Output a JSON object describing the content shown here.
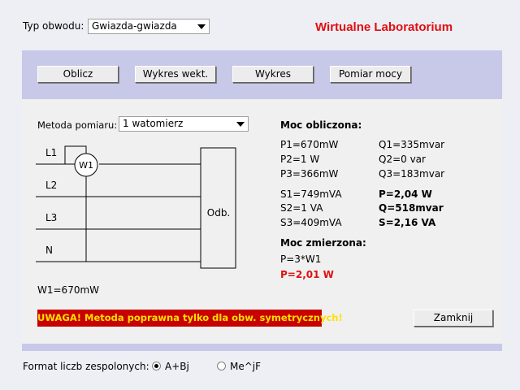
{
  "header": {
    "circuit_type_label": "Typ obwodu:",
    "circuit_type_value": "Gwiazda-gwiazda",
    "app_title": "Wirtualne Laboratorium"
  },
  "toolbar": {
    "calc_label": "Oblicz",
    "vector_chart_label": "Wykres wekt.",
    "chart_label": "Wykres",
    "power_meas_label": "Pomiar mocy"
  },
  "method": {
    "label": "Metoda pomiaru:",
    "value": "1 watomierz"
  },
  "diagram": {
    "lines": [
      "L1",
      "L2",
      "L3",
      "N"
    ],
    "meter_label": "W1",
    "load_label": "Odb."
  },
  "wattmeter_reading": "W1=670mW",
  "calculated": {
    "header": "Moc obliczona:",
    "p1": "P1=670mW",
    "p2": "P2=1 W",
    "p3": "P3=366mW",
    "q1": "Q1=335mvar",
    "q2": "Q2=0 var",
    "q3": "Q3=183mvar",
    "s1": "S1=749mVA",
    "s2": "S2=1 VA",
    "s3": "S3=409mVA",
    "p_total": "P=2,04 W",
    "q_total": "Q=518mvar",
    "s_total": "S=2,16 VA"
  },
  "measured": {
    "header": "Moc zmierzona:",
    "formula": "P=3*W1",
    "result": "P=2,01 W"
  },
  "warning_text": "UWAGA! Metoda poprawna tylko dla obw. symetrycznych!",
  "close_label": "Zamknij",
  "number_format": {
    "label": "Format liczb zespolonych:",
    "options": [
      "A+Bj",
      "Me^jF"
    ],
    "selected": "A+Bj"
  },
  "colors": {
    "title": "#e01010",
    "panel_band": "#c8c8e8",
    "warning_bg": "#c80000",
    "warning_text": "#ffe000"
  }
}
